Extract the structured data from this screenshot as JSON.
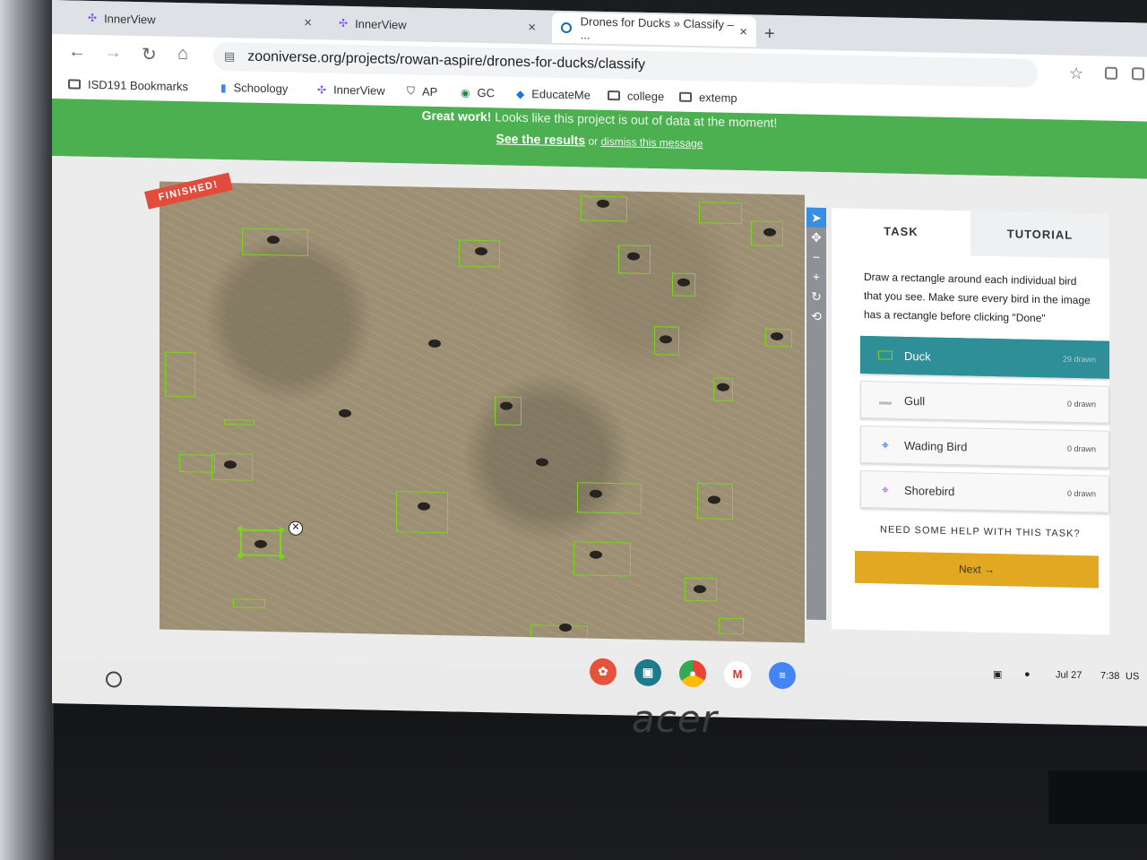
{
  "browser": {
    "tabs": [
      {
        "title": "InnerView"
      },
      {
        "title": "InnerView"
      },
      {
        "title": "Drones for Ducks » Classify – ..."
      }
    ],
    "new_tab": "+",
    "close_glyph": "×",
    "address": "zooniverse.org/projects/rowan-aspire/drones-for-ducks/classify",
    "bookmarks": [
      "ISD191 Bookmarks",
      "Schoology",
      "InnerView",
      "AP",
      "GC",
      "EducateMe",
      "college",
      "extemp"
    ]
  },
  "banner": {
    "message_bold": "Great work!",
    "message": " Looks like this project is out of data at the moment!",
    "results_link": "See the results",
    "or": " or ",
    "dismiss_link": "dismiss this message"
  },
  "classifier": {
    "ribbon": "FINISHED!",
    "tools": [
      "pointer-icon",
      "move-icon",
      "zoom-out-icon",
      "zoom-in-icon",
      "rotate-icon",
      "reset-icon"
    ]
  },
  "task_panel": {
    "tab_task": "TASK",
    "tab_tutorial": "TUTORIAL",
    "instructions": "Draw a rectangle around each individual bird that you see. Make sure every bird in the image has a rectangle before clicking \"Done\"",
    "options": [
      {
        "label": "Duck",
        "count": "29 drawn",
        "icon": "rectangle-icon"
      },
      {
        "label": "Gull",
        "count": "0 drawn",
        "icon": "line-icon"
      },
      {
        "label": "Wading Bird",
        "count": "0 drawn",
        "icon": "crosshair-icon"
      },
      {
        "label": "Shorebird",
        "count": "0 drawn",
        "icon": "crosshair-icon"
      }
    ],
    "help": "NEED SOME HELP WITH THIS TASK?",
    "next": "Next →"
  },
  "shelf": {
    "date": "Jul 27",
    "time": "7:38",
    "region": "US"
  },
  "hardware": {
    "brand": "acer"
  }
}
